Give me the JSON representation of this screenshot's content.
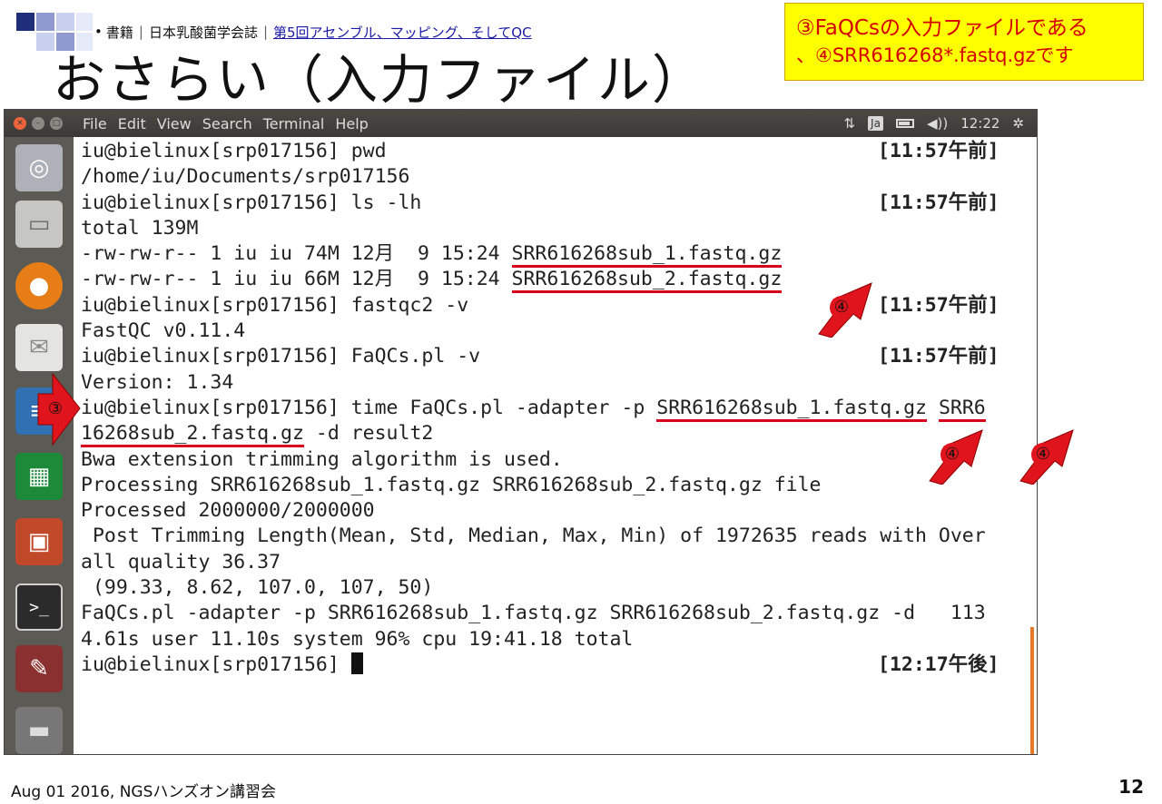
{
  "slide": {
    "bullet": "•",
    "breadcrumb_part1": "書籍",
    "breadcrumb_part2": "日本乳酸菌学会誌",
    "breadcrumb_link": "第5回アセンブル、マッピング、そしてQC",
    "title": "おさらい（入力ファイル）",
    "callout_line1": "③FaQCsの入力ファイルである",
    "callout_line2": "、④SRR616268*.fastq.gzです",
    "footer": "Aug 01 2016, NGSハンズオン講習会",
    "page_number": "12"
  },
  "window": {
    "menus": [
      "File",
      "Edit",
      "View",
      "Search",
      "Terminal",
      "Help"
    ],
    "ime": "Ja",
    "time": "12:22"
  },
  "terminal": {
    "lines": [
      {
        "text": "iu@bielinux[srp017156] pwd",
        "time": "[11:57午前]"
      },
      {
        "text": "/home/iu/Documents/srp017156",
        "time": ""
      },
      {
        "text": "iu@bielinux[srp017156] ls -lh",
        "time": "[11:57午前]"
      },
      {
        "text": "total 139M",
        "time": ""
      },
      {
        "pre": "-rw-rw-r-- 1 iu iu 74M 12月  9 15:24 ",
        "u": "SRR616268sub_1.fastq.gz",
        "time": ""
      },
      {
        "pre": "-rw-rw-r-- 1 iu iu 66M 12月  9 15:24 ",
        "u": "SRR616268sub_2.fastq.gz",
        "time": ""
      },
      {
        "text": "iu@bielinux[srp017156] fastqc2 -v",
        "time": "[11:57午前]"
      },
      {
        "text": "FastQC v0.11.4",
        "time": ""
      },
      {
        "text": "iu@bielinux[srp017156] FaQCs.pl -v",
        "time": "[11:57午前]"
      },
      {
        "text": "Version: 1.34",
        "time": ""
      },
      {
        "pre": "iu@bielinux[srp017156] time FaQCs.pl -adapter -p ",
        "u": "SRR616268sub_1.fastq.gz",
        "mid": " ",
        "u2": "SRR6",
        "time": ""
      },
      {
        "pre": "",
        "u": "16268sub_2.fastq.gz",
        "mid": " -d result2",
        "time": ""
      },
      {
        "text": "Bwa extension trimming algorithm is used.",
        "time": ""
      },
      {
        "text": "Processing SRR616268sub_1.fastq.gz SRR616268sub_2.fastq.gz file",
        "time": ""
      },
      {
        "text": "Processed 2000000/2000000",
        "time": ""
      },
      {
        "text": " Post Trimming Length(Mean, Std, Median, Max, Min) of 1972635 reads with Over",
        "time": ""
      },
      {
        "text": "all quality 36.37",
        "time": ""
      },
      {
        "text": " (99.33, 8.62, 107.0, 107, 50)",
        "time": ""
      },
      {
        "text": "FaQCs.pl -adapter -p SRR616268sub_1.fastq.gz SRR616268sub_2.fastq.gz -d   113",
        "time": ""
      },
      {
        "text": "4.61s user 11.10s system 96% cpu 19:41.18 total",
        "time": ""
      },
      {
        "text": "iu@bielinux[srp017156] ",
        "cursor": true,
        "time": "[12:17午後]"
      }
    ]
  },
  "annotations": {
    "label3": "③",
    "label4": "④"
  }
}
